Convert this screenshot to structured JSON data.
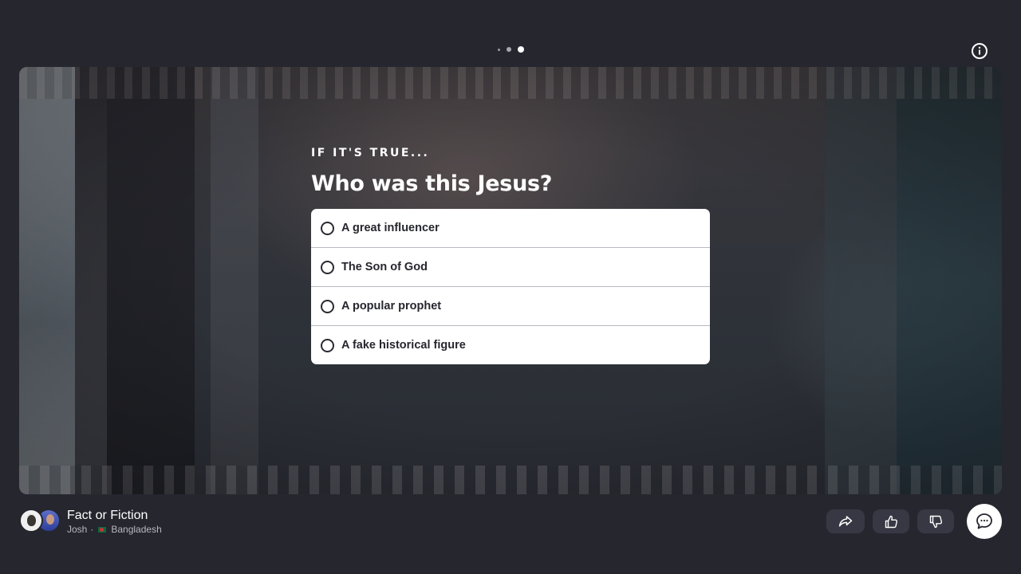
{
  "progress": {
    "steps": 3,
    "current": 3
  },
  "header": {
    "info_icon": "info-icon"
  },
  "card": {
    "eyebrow": "IF IT'S TRUE...",
    "question": "Who was this Jesus?",
    "options": [
      {
        "label": "A great influencer"
      },
      {
        "label": "The Son of God"
      },
      {
        "label": "A popular prophet"
      },
      {
        "label": "A fake historical figure"
      }
    ]
  },
  "footer": {
    "journey_title": "Fact or Fiction",
    "author": "Josh",
    "separator": "·",
    "country": "Bangladesh",
    "icons": {
      "share": "share-icon",
      "like": "thumbs-up-icon",
      "dislike": "thumbs-down-icon",
      "chat": "chat-icon"
    }
  },
  "colors": {
    "background": "#26262f",
    "option_text": "#26262f",
    "pill_bg": "#383844"
  }
}
